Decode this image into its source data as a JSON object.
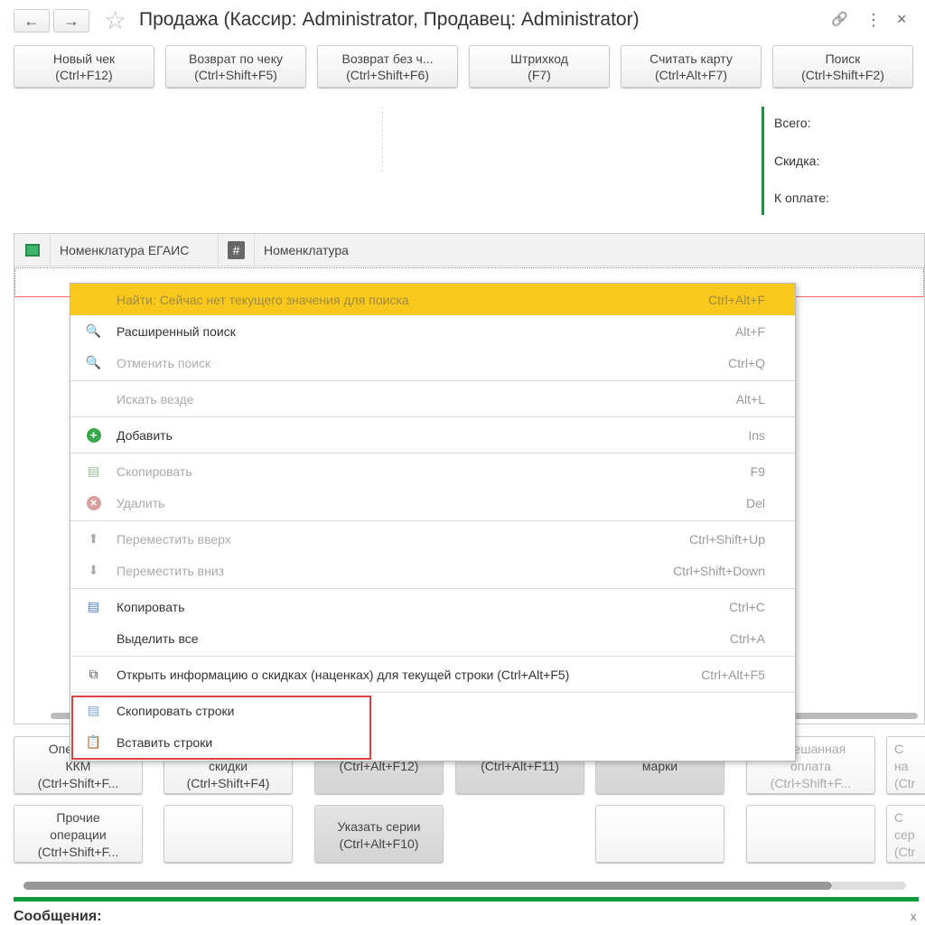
{
  "window": {
    "title": "Продажа (Кассир: Administrator, Продавец: Administrator)",
    "back_icon": "←",
    "forward_icon": "→",
    "star_icon": "☆",
    "link_icon": "🔗",
    "more_icon": "⋮",
    "close_icon": "×"
  },
  "toolbar": [
    {
      "l1": "Новый чек",
      "l2": "(Ctrl+F12)"
    },
    {
      "l1": "Возврат по чеку",
      "l2": "(Ctrl+Shift+F5)"
    },
    {
      "l1": "Возврат без ч...",
      "l2": "(Ctrl+Shift+F6)"
    },
    {
      "l1": "Штрихкод",
      "l2": "(F7)"
    },
    {
      "l1": "Считать карту",
      "l2": "(Ctrl+Alt+F7)"
    },
    {
      "l1": "Поиск",
      "l2": "(Ctrl+Shift+F2)"
    }
  ],
  "totals": {
    "total": "Всего:",
    "discount": "Скидка:",
    "to_pay": "К оплате:"
  },
  "grid": {
    "col1": "Номенклатура ЕГАИС",
    "col2": "Номенклатура",
    "hash": "#"
  },
  "menu": [
    {
      "label": "Найти: Сейчас нет текущего значения для поиска",
      "shortcut": "Ctrl+Alt+F",
      "icon": ""
    },
    {
      "label": "Расширенный поиск",
      "shortcut": "Alt+F",
      "icon": "🔍"
    },
    {
      "label": "Отменить поиск",
      "shortcut": "Ctrl+Q",
      "icon": "🔍"
    },
    {
      "label": "Искать везде",
      "shortcut": "Alt+L",
      "icon": ""
    },
    {
      "label": "Добавить",
      "shortcut": "Ins",
      "icon": "+"
    },
    {
      "label": "Скопировать",
      "shortcut": "F9",
      "icon": "▤"
    },
    {
      "label": "Удалить",
      "shortcut": "Del",
      "icon": "×"
    },
    {
      "label": "Переместить вверх",
      "shortcut": "Ctrl+Shift+Up",
      "icon": "⬆"
    },
    {
      "label": "Переместить вниз",
      "shortcut": "Ctrl+Shift+Down",
      "icon": "⬇"
    },
    {
      "label": "Копировать",
      "shortcut": "Ctrl+C",
      "icon": "▤"
    },
    {
      "label": "Выделить все",
      "shortcut": "Ctrl+A",
      "icon": ""
    },
    {
      "label": "Открыть информацию о скидках (наценках) для текущей строки (Ctrl+Alt+F5)",
      "shortcut": "Ctrl+Alt+F5",
      "icon": "⧉"
    },
    {
      "label": "Скопировать строки",
      "shortcut": "",
      "icon": "▤"
    },
    {
      "label": "Вставить строки",
      "shortcut": "",
      "icon": "📋"
    }
  ],
  "bottom_row1": [
    {
      "t": "Операции\nККМ\n(Ctrl+Shift+F..."
    },
    {
      "t": "Ручные\nскидки\n(Ctrl+Shift+F4)"
    },
    {
      "t": "\n(Ctrl+Alt+F12)"
    },
    {
      "t": "\n(Ctrl+Alt+F11)"
    },
    {
      "t": "\nмарки"
    },
    {
      "t": "Смешанная\nоплата\n(Ctrl+Shift+F..."
    },
    {
      "t": "С\nна\n(Ctr"
    }
  ],
  "bottom_row2": [
    {
      "t": "Прочие\nоперации\n(Ctrl+Shift+F..."
    },
    {
      "t": ""
    },
    {
      "t": "Указать серии\n(Ctrl+Alt+F10)"
    },
    {
      "t": ""
    },
    {
      "t": ""
    },
    {
      "t": "С\nсер\n(Ctr"
    }
  ],
  "messages": {
    "label": "Сообщения:",
    "close": "x"
  },
  "colors": {
    "accent": "#0a9b3c",
    "highlight": "#f8c81c",
    "red_box": "#e04040"
  }
}
